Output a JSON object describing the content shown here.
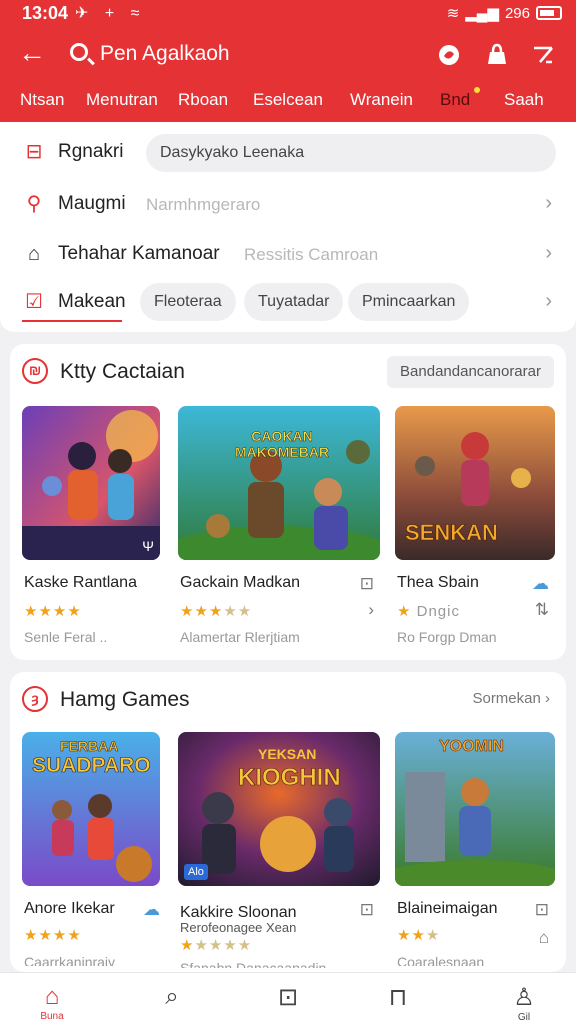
{
  "status": {
    "time": "13:04",
    "left_icons": "✈ + ≈",
    "right_text": "296"
  },
  "header": {
    "search_text": "Pen Agalkaoh",
    "tabs": [
      "Ntsan",
      "Menutran",
      "Rboan",
      "Eselcean",
      "Wranein",
      "Bnd",
      "Saah"
    ]
  },
  "filters": {
    "rows": [
      {
        "label": "Rgnakri",
        "input": "Dasykyako Leenaka"
      },
      {
        "label": "Maugmi",
        "hint": "Narmhmgeraro"
      },
      {
        "label": "Tehahar Kamanoar",
        "hint": "Ressitis Camroan"
      },
      {
        "label": "Makean",
        "chips": [
          "Fleoteraa",
          "Tuyatadar",
          "Pmincaarkan"
        ]
      }
    ]
  },
  "section1": {
    "title": "Ktty Cactaian",
    "button": "Bandandancanorarar",
    "games": [
      {
        "name": "Kaske Rantlana",
        "stars": "★★★★",
        "dim_stars": "",
        "sub": "Senle Feral ..",
        "thumb_badge": "Ψ",
        "action": ""
      },
      {
        "name": "Gackain Madkan",
        "stars": "★★★",
        "dim_stars": "★★",
        "sub": "Alamertar Rlerjtiam",
        "thumb_text": "CAOKAN MAKOMEBAR",
        "action": "›"
      },
      {
        "name": "Thea Sbain",
        "stars": "★",
        "dim_stars": "",
        "sub": "Ro Forgp Dman",
        "suffix": "Dngic",
        "thumb_text": "SENKAN",
        "action": "⇅"
      }
    ]
  },
  "section2": {
    "title": "Hamg Games",
    "link": "Sormekan ›",
    "games": [
      {
        "name": "Anore Ikekar",
        "stars": "★★★★",
        "sub": "Caarrkaninraiy",
        "thumb_text": "SUADPARO",
        "thumb_top": "FERBAA"
      },
      {
        "name": "Kakkire Sloonan",
        "name2": "Rerofeonagee Xean",
        "stars": "★",
        "dim_stars": "★★★★",
        "sub": "Sfanabn Danacaanadin",
        "thumb_text": "KIOGHIN",
        "thumb_top": "YEKSAN",
        "badge": "Alo"
      },
      {
        "name": "Blaineimaigan",
        "stars": "★★",
        "dim_stars": "★",
        "sub": "Coaralesnaan",
        "thumb_text": "YOOMIN"
      }
    ]
  },
  "bottomnav": {
    "home_label": "Buna",
    "profile_label": "Gil"
  },
  "colors": {
    "accent": "#e53235",
    "star": "#f2a21a"
  }
}
